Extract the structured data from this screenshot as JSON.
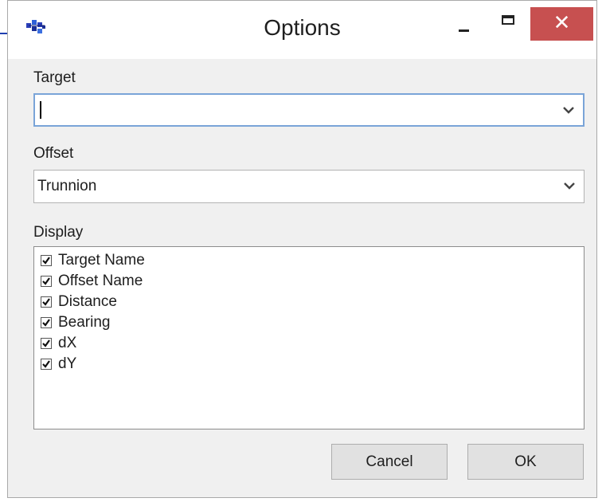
{
  "window": {
    "title": "Options",
    "close_glyph": "✕"
  },
  "target": {
    "label": "Target",
    "value": ""
  },
  "offset": {
    "label": "Offset",
    "value": "Trunnion"
  },
  "display": {
    "label": "Display",
    "items": [
      {
        "label": "Target Name",
        "checked": true
      },
      {
        "label": "Offset Name",
        "checked": true
      },
      {
        "label": "Distance",
        "checked": true
      },
      {
        "label": "Bearing",
        "checked": true
      },
      {
        "label": "dX",
        "checked": true
      },
      {
        "label": "dY",
        "checked": true
      }
    ]
  },
  "buttons": {
    "cancel": "Cancel",
    "ok": "OK"
  },
  "icons": {
    "app": "app-network-icon",
    "dropdown": "chevron-down-icon",
    "check": "checkmark-icon"
  },
  "colors": {
    "close_bg": "#c75050",
    "focus_border": "#7aa4d8"
  }
}
